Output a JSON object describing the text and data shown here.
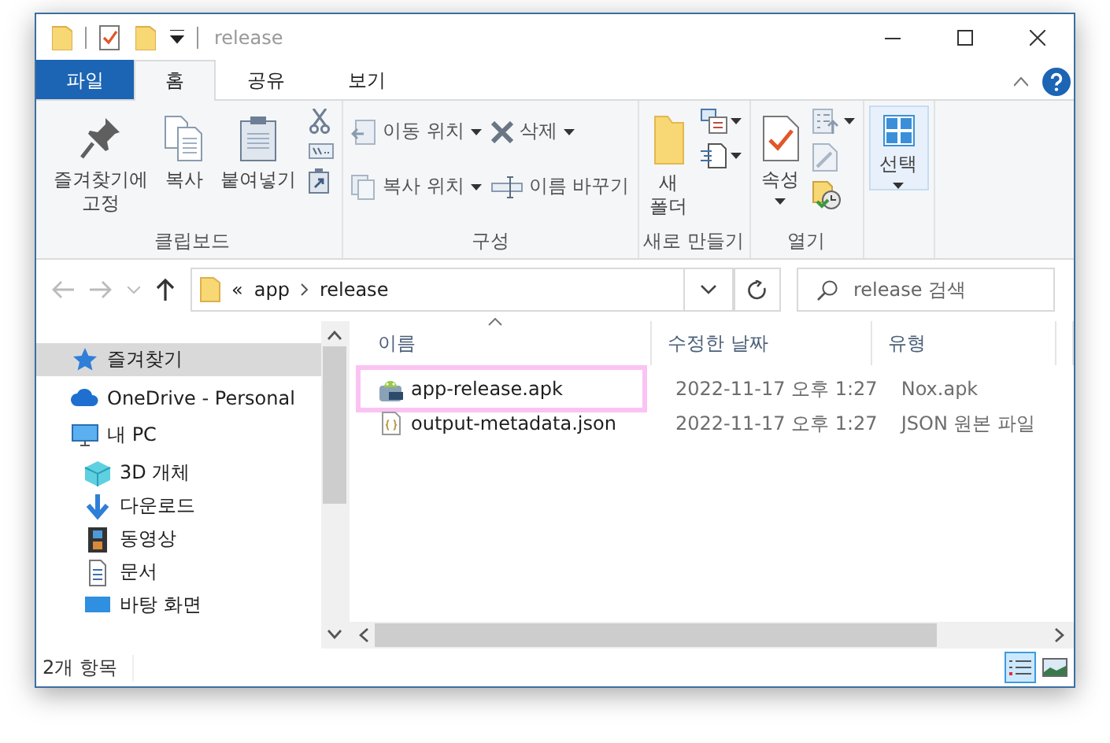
{
  "window": {
    "title": "release"
  },
  "ribbon_tabs": [
    {
      "label": "파일",
      "kind": "file",
      "selected": false
    },
    {
      "label": "홈",
      "kind": "tab",
      "selected": true
    },
    {
      "label": "공유",
      "kind": "tab",
      "selected": false
    },
    {
      "label": "보기",
      "kind": "tab",
      "selected": false
    }
  ],
  "ribbon_groups": [
    {
      "label": "클립보드",
      "columns": [
        [
          {
            "kind": "large",
            "label": "즐겨찾기에\n고정",
            "dropdown": false,
            "selected": false
          }
        ],
        [
          {
            "kind": "large",
            "label": "복사",
            "dropdown": false,
            "selected": false
          }
        ],
        [
          {
            "kind": "large",
            "label": "붙여넣기",
            "dropdown": false,
            "selected": false
          }
        ],
        [
          {
            "kind": "icon",
            "dropdown": false
          },
          {
            "kind": "icon",
            "dropdown": false
          },
          {
            "kind": "icon",
            "dropdown": false
          }
        ]
      ]
    },
    {
      "label": "구성",
      "columns": [
        [
          {
            "kind": "small",
            "label": "이동 위치",
            "dropdown": true
          },
          {
            "kind": "small",
            "label": "복사 위치",
            "dropdown": true
          }
        ],
        [
          {
            "kind": "small",
            "label": "삭제",
            "dropdown": true
          },
          {
            "kind": "small",
            "label": "이름 바꾸기",
            "dropdown": false
          }
        ]
      ]
    },
    {
      "label": "새로 만들기",
      "columns": [
        [
          {
            "kind": "large",
            "label": "새\n폴더",
            "dropdown": false,
            "selected": false
          }
        ],
        [
          {
            "kind": "icon",
            "dropdown": true
          },
          {
            "kind": "icon",
            "dropdown": true
          }
        ]
      ]
    },
    {
      "label": "열기",
      "columns": [
        [
          {
            "kind": "large",
            "label": "속성",
            "dropdown": true,
            "selected": false
          }
        ],
        [
          {
            "kind": "icon",
            "dropdown": true
          },
          {
            "kind": "icon",
            "dropdown": false
          },
          {
            "kind": "icon",
            "dropdown": false
          }
        ]
      ]
    },
    {
      "columns": [
        [
          {
            "kind": "large",
            "label": "선택",
            "dropdown": true,
            "selected": true
          }
        ]
      ]
    }
  ],
  "address": {
    "overflow_marker": "«",
    "path": [
      "app",
      "release"
    ],
    "search_placeholder": "release 검색"
  },
  "nav": {
    "items": [
      {
        "label": "즐겨찾기",
        "selected": true
      },
      {
        "label": "OneDrive - Personal",
        "selected": false
      },
      {
        "label": "내 PC",
        "selected": false,
        "children": [
          {
            "label": "3D 개체",
            "selected": false
          },
          {
            "label": "다운로드",
            "selected": false
          },
          {
            "label": "동영상",
            "selected": false
          },
          {
            "label": "문서",
            "selected": false
          },
          {
            "label": "바탕 화면",
            "selected": false
          }
        ]
      }
    ]
  },
  "files": {
    "columns": [
      {
        "label": "이름",
        "sorted": true
      },
      {
        "label": "수정한 날짜",
        "sorted": false
      },
      {
        "label": "유형",
        "sorted": false
      }
    ],
    "rows": [
      {
        "name": "app-release.apk",
        "date": "2022-11-17 오후 1:27",
        "type": "Nox.apk",
        "kind": "apk",
        "highlighted": true
      },
      {
        "name": "output-metadata.json",
        "date": "2022-11-17 오후 1:27",
        "type": "JSON 원본 파일",
        "kind": "json",
        "highlighted": false
      }
    ]
  },
  "status_bar": {
    "count": "2개 항목",
    "views": [
      {
        "kind": "details",
        "selected": true
      },
      {
        "kind": "large-icons",
        "selected": false
      }
    ]
  }
}
